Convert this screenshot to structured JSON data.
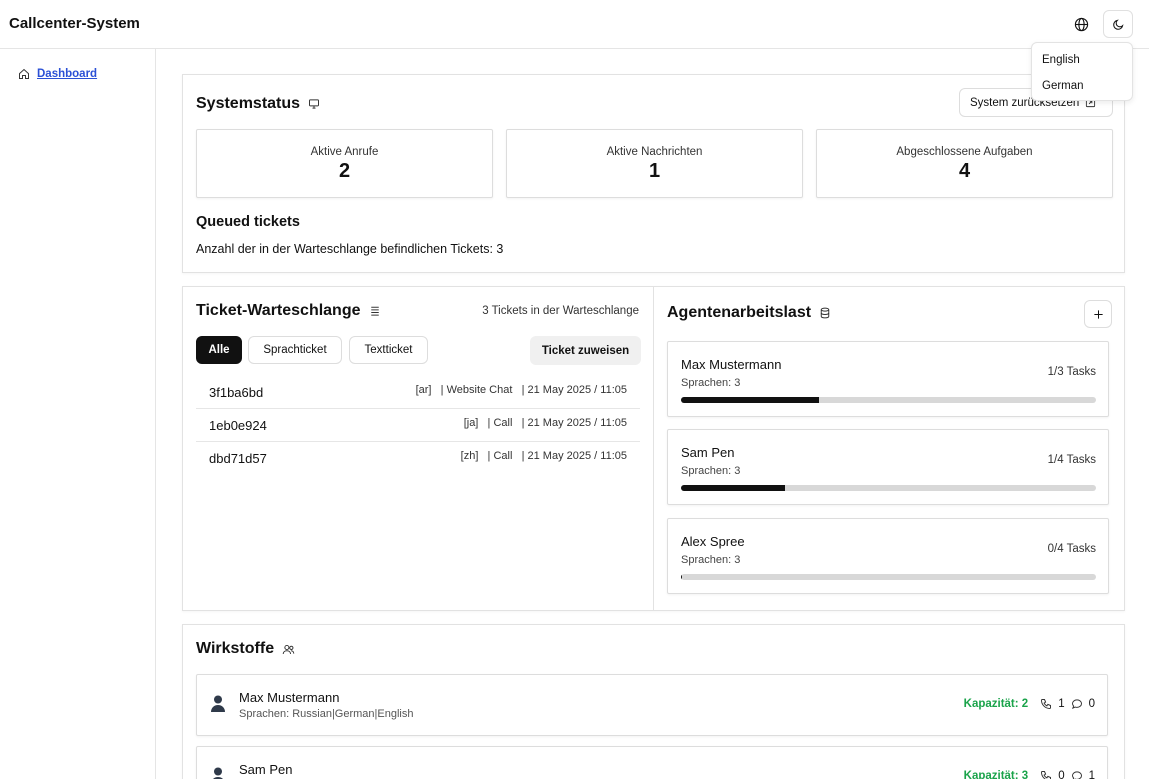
{
  "header": {
    "title": "Callcenter-System"
  },
  "language_menu": {
    "items": [
      "English",
      "German"
    ]
  },
  "sidebar": {
    "items": [
      {
        "label": "Dashboard",
        "icon": "home-icon"
      }
    ]
  },
  "system_status": {
    "title": "Systemstatus",
    "reset_label": "System zurücksetzen",
    "stats": [
      {
        "label": "Aktive Anrufe",
        "value": "2"
      },
      {
        "label": "Aktive Nachrichten",
        "value": "1"
      },
      {
        "label": "Abgeschlossene Aufgaben",
        "value": "4"
      }
    ],
    "queued_title": "Queued tickets",
    "queued_text": "Anzahl der in der Warteschlange befindlichen Tickets: 3"
  },
  "ticket_queue": {
    "title": "Ticket-Warteschlange",
    "count_text": "3 Tickets in der Warteschlange",
    "filters": [
      "Alle",
      "Sprachticket",
      "Textticket"
    ],
    "assign_label": "Ticket zuweisen",
    "tickets": [
      {
        "id": "3f1ba6bd",
        "lang": "[ar]",
        "channel": "| Website Chat",
        "date": "| 21 May 2025 / 11:05"
      },
      {
        "id": "1eb0e924",
        "lang": "[ja]",
        "channel": "| Call",
        "date": "| 21 May 2025 / 11:05"
      },
      {
        "id": "dbd71d57",
        "lang": "[zh]",
        "channel": "| Call",
        "date": "| 21 May 2025 / 11:05"
      }
    ]
  },
  "agent_workload": {
    "title": "Agentenarbeitslast",
    "agents": [
      {
        "name": "Max Mustermann",
        "languages": "Sprachen: 3",
        "tasks": "1/3 Tasks",
        "load": 0.333
      },
      {
        "name": "Sam Pen",
        "languages": "Sprachen: 3",
        "tasks": "1/4 Tasks",
        "load": 0.25
      },
      {
        "name": "Alex Spree",
        "languages": "Sprachen: 3",
        "tasks": "0/4 Tasks",
        "load": 0.0
      }
    ]
  },
  "agents": {
    "title": "Wirkstoffe",
    "items": [
      {
        "name": "Max Mustermann",
        "languages": "Sprachen: Russian|German|English",
        "capacity": "Kapazität: 2",
        "calls": "1",
        "messages": "0"
      },
      {
        "name": "Sam Pen",
        "languages": "",
        "capacity": "Kapazität: 3",
        "calls": "0",
        "messages": "1"
      }
    ]
  },
  "colors": {
    "accent_link": "#2b50d6",
    "capacity_green": "#1aa34a",
    "primary_dark": "#111111"
  }
}
